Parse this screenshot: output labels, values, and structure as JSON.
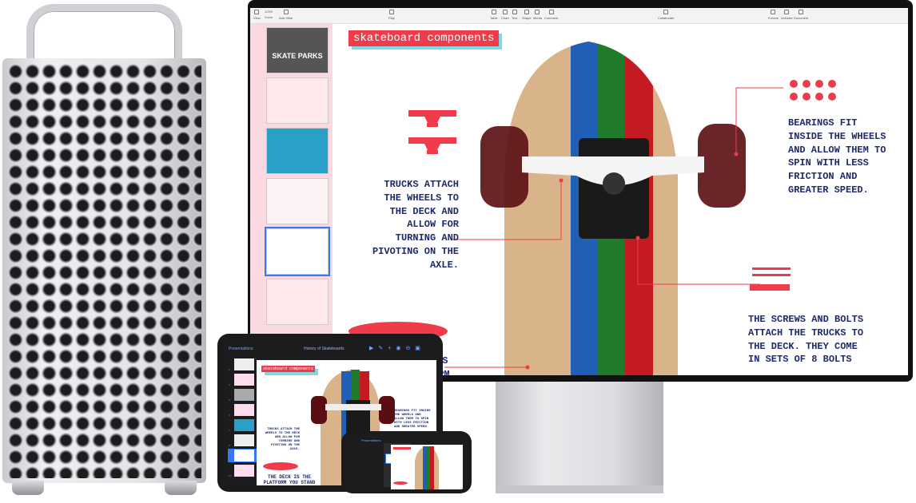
{
  "display": {
    "toolbar": [
      {
        "label": "View"
      },
      {
        "label": "Zoom",
        "value": "125%"
      },
      {
        "label": "Add Slide"
      },
      {
        "label": "Play"
      },
      {
        "label": "Table"
      },
      {
        "label": "Chart"
      },
      {
        "label": "Text"
      },
      {
        "label": "Shape"
      },
      {
        "label": "Media"
      },
      {
        "label": "Comment"
      },
      {
        "label": "Collaborate"
      },
      {
        "label": "Format"
      },
      {
        "label": "Animate"
      },
      {
        "label": "Document"
      }
    ],
    "slide": {
      "title": "skateboard components",
      "trucks_text": "TRUCKS ATTACH THE WHEELS TO THE DECK AND ALLOW FOR TURNING AND PIVOTING ON THE AXLE.",
      "bearings_text": "BEARINGS FIT INSIDE THE WHEELS AND ALLOW THEM TO SPIN WITH LESS FRICTION AND GREATER SPEED.",
      "screws_text": "THE SCREWS AND BOLTS ATTACH THE TRUCKS TO THE DECK. THEY COME IN SETS OF 8 BOLTS",
      "deck_text": "THE DECK IS THE PLATFORM YOU STAND ON.",
      "deck_visible_1": "IS",
      "deck_visible_2": "ORM"
    },
    "thumb_titles": [
      "SKATE PARKS"
    ]
  },
  "ipad": {
    "back_label": "Presentations",
    "doc_title": "History of Skateboards",
    "slide_numbers": [
      "3",
      "4",
      "5",
      "6",
      "7",
      "8",
      "9",
      "10"
    ]
  },
  "iphone": {
    "back_label": "Presentations"
  },
  "colors": {
    "accent_red": "#ef3b4a",
    "text_navy": "#1f2a6b",
    "nav_pink": "#fbd9e0",
    "select_blue": "#3478f6",
    "stripe_blue": "#1f5fb5",
    "stripe_green": "#1f7a2a",
    "stripe_red": "#c41a22"
  }
}
